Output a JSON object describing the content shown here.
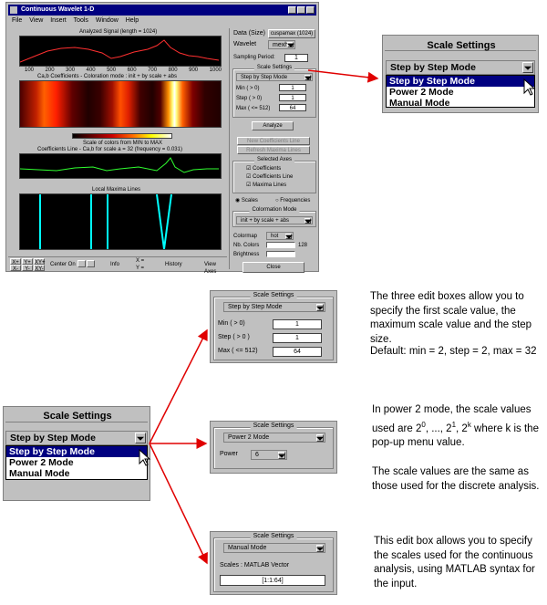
{
  "window": {
    "title": "Continuous Wavelet 1-D",
    "menu": [
      "File",
      "View",
      "Insert",
      "Tools",
      "Window",
      "Help"
    ],
    "data_label": "Data (Size)",
    "data_value": "cuspamax (1024)",
    "wavelet_label": "Wavelet",
    "wavelet_value": "mexh",
    "sampling_label": "Sampling Period:",
    "sampling_value": "1",
    "scale_settings_title": "Scale Settings",
    "scale_mode": "Step by Step Mode",
    "min_label": "Min ( > 0)",
    "min_value": "1",
    "step_label": "Step ( > 0)",
    "step_value": "1",
    "max_label": "Max ( <= 512)",
    "max_value": "64",
    "analyze_label": "Analyze",
    "new_coef_label": "New Coefficients Line",
    "refresh_label": "Refresh Maxima Lines",
    "selected_axes_title": "Selected Axes",
    "axes_options": [
      "Coefficients",
      "Coefficients Line",
      "Maxima Lines"
    ],
    "scales_label": "Scales",
    "frequencies_label": "Frequencies",
    "colormation_title": "Colormation Mode",
    "colormation_value": "init + by scale + abs",
    "colormap_label": "Colormap",
    "colormap_value": "hot",
    "nb_colors_label": "Nb. Colors",
    "nb_colors_value": "128",
    "brightness_label": "Brightness",
    "close_label": "Close",
    "plot1_title": "Analyzed Signal (length = 1024)",
    "plot2_title": "Ca,b Coefficients - Coloration mode : init + by scale + abs",
    "plot2_sub": "Scale of colors from MIN to MAX",
    "plot3_title": "Coefficients Line - Ca,b for scale a = 32 (frequency = 0.031)",
    "plot4_title": "Local Maxima Lines",
    "x_ticks": [
      "100",
      "200",
      "300",
      "400",
      "500",
      "600",
      "700",
      "800",
      "900",
      "1000"
    ],
    "bottom_bar": {
      "btn_x": "X+",
      "btn_y": "Y+",
      "btn_xy": "XY+",
      "btn_xm": "X-",
      "btn_ym": "Y-",
      "btn_xym": "XY-",
      "center_on": "Center On",
      "info": "Info",
      "x_label": "X =",
      "y_label": "Y =",
      "history": "History",
      "view_axes": "View Axes"
    }
  },
  "top_popup": {
    "title": "Scale Settings",
    "value": "Step by Step Mode",
    "options": [
      "Step by Step Mode",
      "Power 2 Mode",
      "Manual Mode"
    ]
  },
  "left_popup": {
    "title": "Scale Settings",
    "value": "Step by Step Mode",
    "options": [
      "Step by Step Mode",
      "Power 2 Mode",
      "Manual Mode"
    ]
  },
  "panel_step": {
    "title": "Scale Settings",
    "mode": "Step by Step Mode",
    "min_label": "Min  ( > 0)",
    "min_value": "1",
    "step_label": "Step  ( > 0 )",
    "step_value": "1",
    "max_label": "Max  ( <= 512)",
    "max_value": "64"
  },
  "panel_power": {
    "title": "Scale Settings",
    "mode": "Power 2 Mode",
    "power_label": "Power",
    "power_value": "6"
  },
  "panel_manual": {
    "title": "Scale Settings",
    "mode": "Manual Mode",
    "scales_label": "Scales : MATLAB Vector",
    "scales_value": "[1:1:64]"
  },
  "descriptions": {
    "step_para": "The three edit boxes allow you to specify the first scale value, the maximum scale value and the step size.",
    "step_default": "Default: min = 2, step = 2, max = 32",
    "power_para_prefix": "In power 2 mode, the scale values used are 2",
    "power_para_mid": ", ..., 2",
    "power_para_mid2": ", 2",
    "power_para_suffix": " where k is the pop-up menu value.",
    "sup0": "0",
    "sup1": "1",
    "supk": "k",
    "power_para2": "The scale values are the same as those used for the discrete analysis.",
    "manual_para": "This edit box allows you to specify the scales used for the continuous analysis, using MATLAB syntax for the input."
  },
  "colors": {
    "arrow": "#e00000",
    "title_bar": "#000080",
    "selection": "#000080",
    "panel_gray": "#c0c0c0",
    "plot_red": "#ff3030",
    "plot_green": "#30ff30",
    "plot_cyan": "#00ffff"
  }
}
